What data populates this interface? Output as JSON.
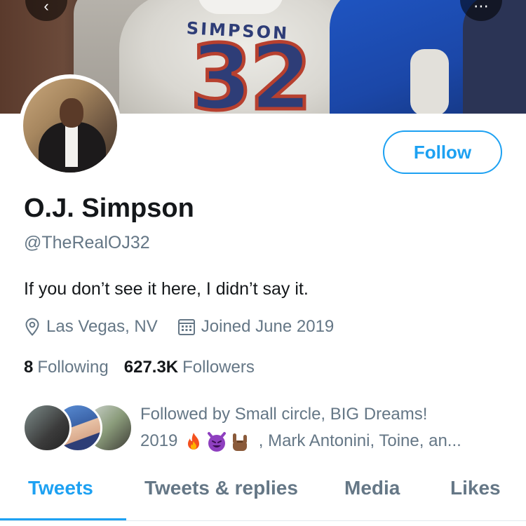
{
  "profile": {
    "name": "O.J. Simpson",
    "handle": "@TheRealOJ32",
    "bio": "If you don’t see it here, I didn’t say it.",
    "location": "Las Vegas, NV",
    "joined": "Joined June 2019",
    "follow_label": "Follow"
  },
  "banner": {
    "jersey_name": "SIMPSON",
    "jersey_number": "32"
  },
  "stats": {
    "following_count": "8",
    "following_label": "Following",
    "followers_count": "627.3K",
    "followers_label": "Followers"
  },
  "followed_by": {
    "line1": "Followed by Small circle, BIG Dreams!",
    "line2_prefix": "2019",
    "emojis": [
      "fire-icon",
      "smiling-devil-icon",
      "sign-of-horns-icon"
    ],
    "line2_suffix": ", Mark Antonini, Toine, an..."
  },
  "tabs": [
    {
      "label": "Tweets",
      "active": true
    },
    {
      "label": "Tweets & replies",
      "active": false
    },
    {
      "label": "Media",
      "active": false
    },
    {
      "label": "Likes",
      "active": false
    }
  ],
  "colors": {
    "accent": "#1da1f2",
    "secondary_text": "#657786",
    "primary_text": "#14171a"
  }
}
